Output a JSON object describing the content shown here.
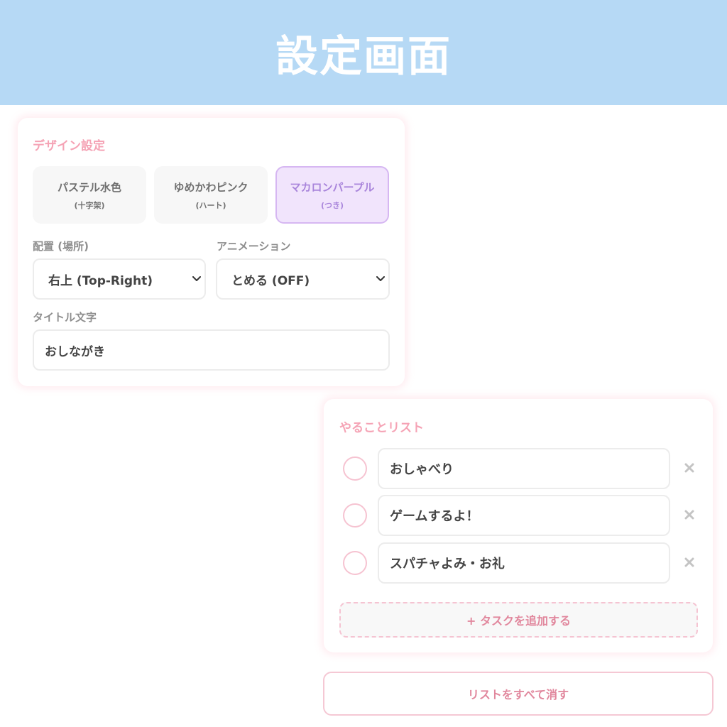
{
  "header": {
    "title": "設定画面"
  },
  "design": {
    "title": "デザイン設定",
    "themes": [
      {
        "name": "パステル水色",
        "sub": "(十字架)",
        "selected": false
      },
      {
        "name": "ゆめかわピンク",
        "sub": "(ハート)",
        "selected": false
      },
      {
        "name": "マカロンパープル",
        "sub": "(つき)",
        "selected": true
      }
    ],
    "position_label": "配置 (場所)",
    "position_value": "右上 (Top-Right)",
    "animation_label": "アニメーション",
    "animation_value": "とめる (OFF)",
    "title_text_label": "タイトル文字",
    "title_text_value": "おしながき"
  },
  "todo": {
    "title": "やることリスト",
    "tasks": [
      {
        "text": "おしゃべり",
        "done": false
      },
      {
        "text": "ゲームするよ！",
        "done": false
      },
      {
        "text": "スパチャよみ・お礼",
        "done": false
      }
    ],
    "add_label": "+ タスクを追加する"
  },
  "clear_all_label": "リストをすべて消す",
  "colors": {
    "header_bg": "#b6d9f5",
    "accent_pink": "#f5a3b5",
    "selected_purple": "#a985db",
    "selected_purple_bg": "#f1e4fc"
  },
  "icons": {
    "select_arrow": "chevron-down-icon",
    "delete": "close-icon",
    "task_check": "circle-check-icon"
  }
}
